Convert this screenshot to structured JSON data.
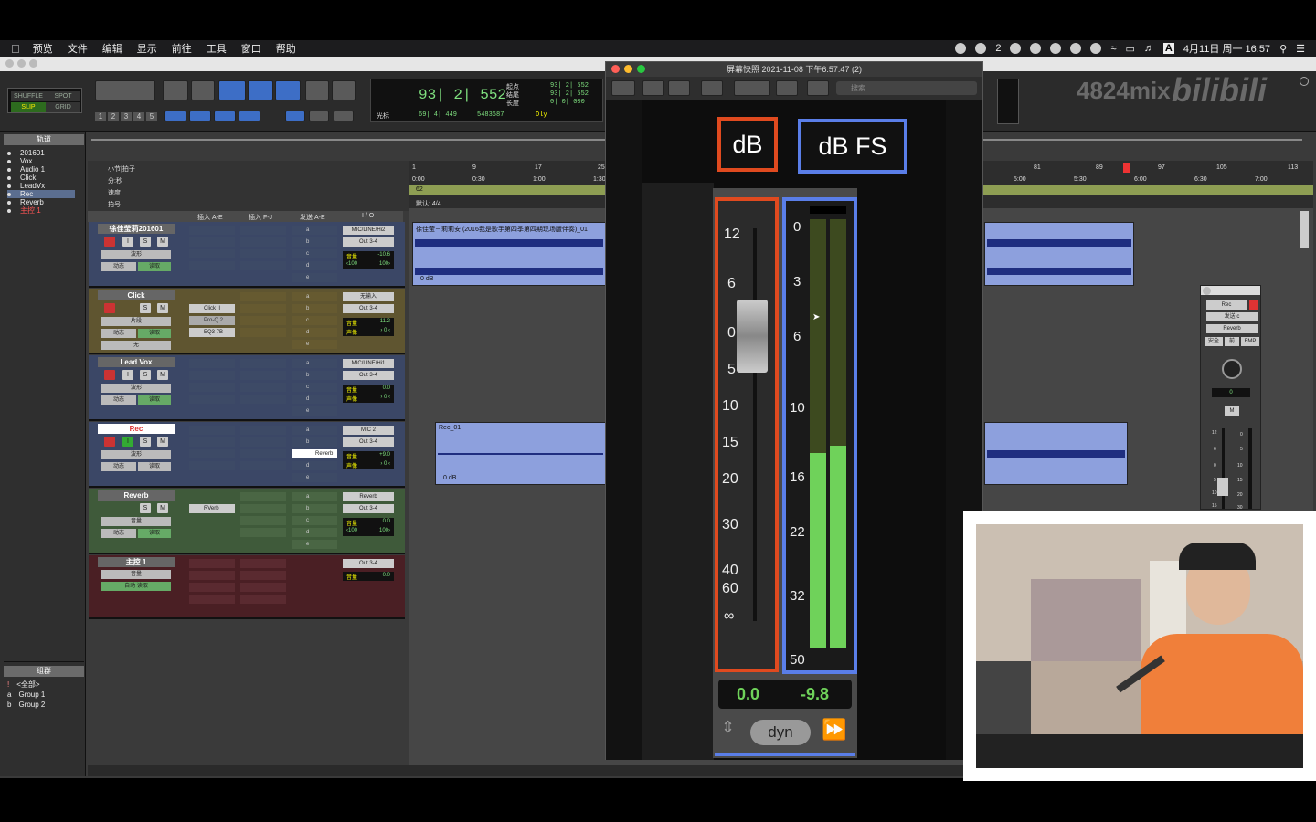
{
  "menubar": {
    "items": [
      "预览",
      "文件",
      "编辑",
      "显示",
      "前往",
      "工具",
      "窗口",
      "帮助"
    ],
    "wechat_count": "2",
    "datetime": "4月11日 周一 16:57"
  },
  "toolbar": {
    "modes": [
      "SHUFFLE",
      "SPOT",
      "SLIP",
      "GRID"
    ],
    "numbers": [
      "1",
      "2",
      "3",
      "4",
      "5"
    ]
  },
  "counter": {
    "main": "93| 2| 552",
    "start_label": "起点",
    "end_label": "结尾",
    "length_label": "长度",
    "start": "93| 2| 552",
    "end": "93| 2| 552",
    "length": "0| 0| 000",
    "cursor_label": "光标",
    "cursor": "69| 4| 449",
    "samples": "5483687",
    "dly": "Dly"
  },
  "watermark": {
    "text": "4824mix",
    "logo": "bilibili"
  },
  "sidebar": {
    "tracks_header": "轨道",
    "tracks": [
      "201601",
      "Vox",
      "Audio 1",
      "Click",
      "LeadVx",
      "Rec",
      "Reverb",
      "主控 1"
    ],
    "groups_header": "组群",
    "groups": [
      "<全部>",
      "Group 1",
      "Group 2"
    ],
    "group_keys": [
      "!",
      "a",
      "b"
    ]
  },
  "ruler": {
    "bars_label": "小节|拍子",
    "minsec_label": "分:秒",
    "tempo_label": "速度",
    "meter_label": "拍号",
    "tempo_value": "62",
    "meter_value": "默认: 4/4",
    "bar_ticks": [
      "1",
      "9",
      "17",
      "25",
      "81",
      "89",
      "97",
      "105",
      "113"
    ],
    "time_ticks": [
      "0:00",
      "0:30",
      "1:00",
      "1:30",
      "5:00",
      "5:30",
      "6:00",
      "6:30",
      "7:00"
    ]
  },
  "mixer": {
    "headers": [
      "插入 A-E",
      "插入 F-J",
      "发送 A-E",
      "I / O"
    ],
    "strips": [
      {
        "name": "徐佳莹莉201601",
        "view": "波形",
        "auto": "动态",
        "read": "读取",
        "inputs": [
          "MIC/LINE/Hi2"
        ],
        "out": "Out 3-4",
        "vol_label": "音量",
        "vol": "-10.6",
        "pan_l": "‹100",
        "pan_r": "100›",
        "sends": [
          "a",
          "b",
          "c",
          "d",
          "e"
        ],
        "inserts": []
      },
      {
        "name": "Click",
        "view": "片段",
        "auto": "动态",
        "read": "读取",
        "inputs": [
          "无输入"
        ],
        "out": "Out 3-4",
        "vol_label": "音量",
        "vol": "-11.2",
        "pan_label": "声像",
        "pan": "› 0 ‹",
        "sends": [
          "a",
          "b",
          "c",
          "d",
          "e"
        ],
        "inserts": [
          "Click II",
          "Pro-Q 2",
          "EQ3 7B"
        ],
        "extra": "无"
      },
      {
        "name": "Lead Vox",
        "view": "波形",
        "auto": "动态",
        "read": "读取",
        "inputs": [
          "MIC/LINE/Hi1"
        ],
        "out": "Out 3-4",
        "vol_label": "音量",
        "vol": "0.0",
        "pan_label": "声像",
        "pan": "› 0 ‹",
        "sends": [
          "a",
          "b",
          "c",
          "d",
          "e"
        ],
        "inserts": []
      },
      {
        "name": "Rec",
        "view": "波形",
        "auto": "动态",
        "read": "读取",
        "inputs": [
          "MIC 2"
        ],
        "out": "Out 3-4",
        "vol_label": "音量",
        "vol": "+9.0",
        "pan_label": "声像",
        "pan": "› 0 ‹",
        "sends": [
          "a",
          "b",
          "c",
          "d",
          "e"
        ],
        "send_c": "Reverb",
        "inserts": []
      },
      {
        "name": "Reverb",
        "view": "音量",
        "auto": "动态",
        "read": "读取",
        "inputs": [
          "Reverb"
        ],
        "out": "Out 3-4",
        "vol_label": "音量",
        "vol": "0.0",
        "pan_l": "‹100",
        "pan_r": "100›",
        "sends": [
          "a",
          "b",
          "c",
          "d",
          "e"
        ],
        "inserts": [
          "RVerb"
        ]
      },
      {
        "name": "主控 1",
        "view": "音量",
        "auto": "自动 读取",
        "out": "Out 3-4",
        "vol_label": "音量",
        "vol": "0.0"
      }
    ]
  },
  "clips": {
    "top": "徐佳莹－莉莉安 (2016我是歌手第四季第四期现场版伴奏)_01",
    "rec": "Rec_01",
    "gain": "0 dB"
  },
  "viewer": {
    "title": "屏幕快照 2021-11-08 下午6.57.47 (2)",
    "search_placeholder": "搜索",
    "db_label": "dB",
    "dbfs_label": "dB FS",
    "db_scale": [
      "12",
      "6",
      "0",
      "5",
      "10",
      "15",
      "20",
      "30",
      "40",
      "60",
      "∞"
    ],
    "dbfs_scale": [
      "0",
      "3",
      "6",
      "10",
      "16",
      "22",
      "32",
      "50"
    ],
    "fader_value": "0.0",
    "meter_value": "-9.8",
    "dyn": "dyn"
  },
  "send_dialog": {
    "track": "Rec",
    "send": "发送 c",
    "bus": "Reverb",
    "safe": "安全",
    "pre": "前",
    "fmp": "FMP",
    "level": "0",
    "mute": "M",
    "scale": [
      "12",
      "6",
      "0",
      "5",
      "10",
      "15"
    ],
    "scale_r": [
      "0",
      "5",
      "10",
      "15",
      "20",
      "30"
    ]
  },
  "colors": {
    "db_box": "#e04a1f",
    "dbfs_box": "#5a7ee8",
    "meter_green": "#6fd25a",
    "counter_green": "#7fe07f"
  }
}
